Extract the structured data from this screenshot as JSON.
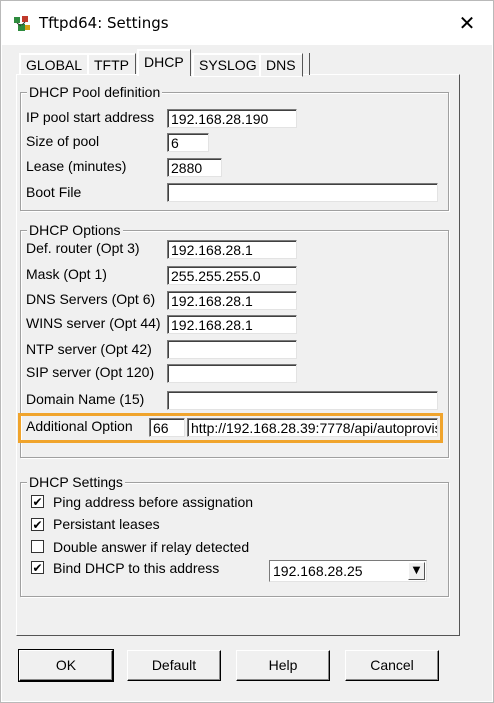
{
  "window": {
    "title": "Tftpd64: Settings",
    "close_glyph": "✕"
  },
  "tabs": [
    {
      "label": "GLOBAL"
    },
    {
      "label": "TFTP"
    },
    {
      "label": "DHCP",
      "active": true
    },
    {
      "label": "SYSLOG"
    },
    {
      "label": "DNS"
    }
  ],
  "pool": {
    "legend": "DHCP Pool definition",
    "start_label": "IP pool start address",
    "start_value": "192.168.28.190",
    "size_label": "Size of pool",
    "size_value": "6",
    "lease_label": "Lease (minutes)",
    "lease_value": "2880",
    "boot_label": "Boot File",
    "boot_value": ""
  },
  "options": {
    "legend": "DHCP Options",
    "router_label": "Def. router (Opt 3)",
    "router_value": "192.168.28.1",
    "mask_label": "Mask (Opt 1)",
    "mask_value": "255.255.255.0",
    "dns_label": "DNS Servers (Opt 6)",
    "dns_value": "192.168.28.1",
    "wins_label": "WINS server (Opt 44)",
    "wins_value": "192.168.28.1",
    "ntp_label": "NTP server (Opt 42)",
    "ntp_value": "",
    "sip_label": "SIP server (Opt 120)",
    "sip_value": "",
    "domain_label": "Domain Name (15)",
    "domain_value": "",
    "additional_label": "Additional Option",
    "additional_number": "66",
    "additional_value": "http://192.168.28.39:7778/api/autoprovis",
    "highlight_color": "#f0a42c"
  },
  "settings": {
    "legend": "DHCP Settings",
    "ping_label": "Ping address before assignation",
    "ping_checked": true,
    "persistant_label": "Persistant leases",
    "persistant_checked": true,
    "double_label": "Double answer if relay detected",
    "double_checked": false,
    "bind_label": "Bind DHCP to this address",
    "bind_checked": true,
    "bind_address": "192.168.28.25"
  },
  "buttons": {
    "ok": "OK",
    "default": "Default",
    "help": "Help",
    "cancel": "Cancel"
  },
  "glyphs": {
    "check": "✔",
    "dropdown": "▼"
  }
}
